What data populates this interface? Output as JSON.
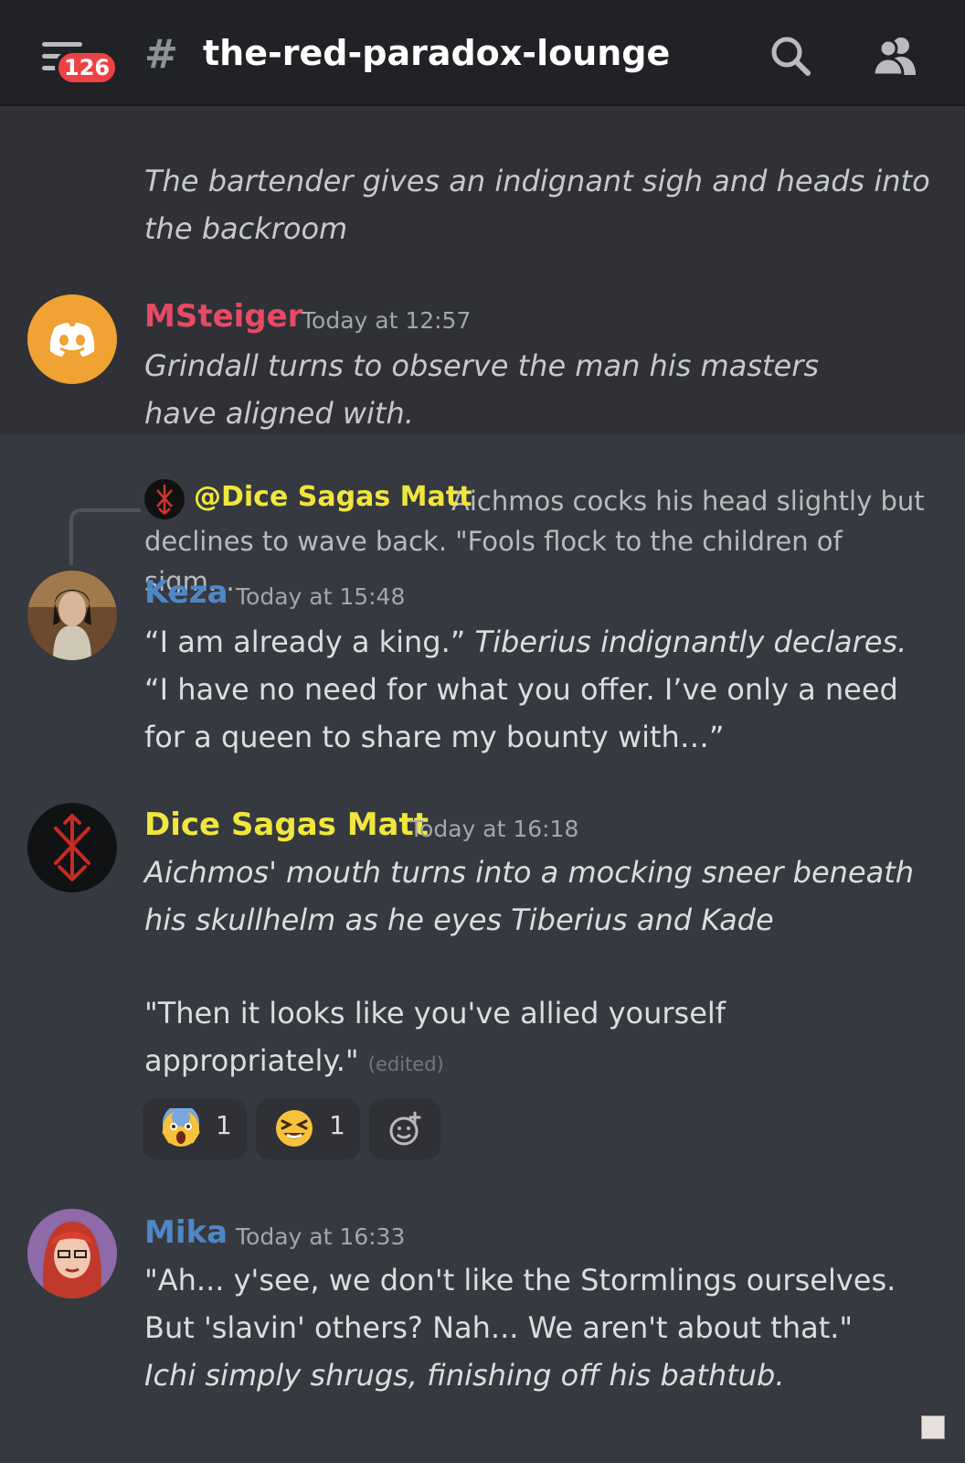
{
  "header": {
    "notification_count": "126",
    "channel_hash": "#",
    "channel_name": "the-red-paradox-lounge"
  },
  "messages": [
    {
      "continuation_text": "The bartender gives an indignant sigh and heads into the backroom"
    },
    {
      "author": "MSteiger",
      "author_color": "#e84a64",
      "timestamp": "Today at 12:57",
      "text": "Grindall turns to observe the man his masters have aligned with."
    },
    {
      "reply": {
        "mention": "@Dice Sagas Matt",
        "preview": "Aichmos cocks his head slightly but declines to wave back.  \"Fools flock to the children of sigm…"
      },
      "author": "Keza",
      "author_color": "#4f86c6",
      "timestamp": "Today at 15:48",
      "text_part1": "“I am already a king.” ",
      "text_part2": "Tiberius indignantly declares.",
      "text_part3": " “I have no need for what you offer. I’ve only a need for a queen to share my bounty with…”"
    },
    {
      "author": "Dice Sagas Matt",
      "author_color": "#f0e63c",
      "timestamp": "Today at 16:18",
      "text_italic": "Aichmos' mouth turns into a mocking sneer beneath his skullhelm as he eyes Tiberius and Kade",
      "text_quote": "\"Then it looks like you've allied yourself appropriately.\"",
      "edited": "(edited)",
      "reactions": [
        {
          "emoji": "screaming-face",
          "count": "1"
        },
        {
          "emoji": "laughing-squint-face",
          "count": "1"
        }
      ]
    },
    {
      "author": "Mika",
      "author_color": "#4f86c6",
      "timestamp": "Today at 16:33",
      "text_line1": "\"Ah... y'see, we don't like the Stormlings ourselves.",
      "text_line2": "But 'slavin' others? Nah... We aren't about that.\"",
      "text_line3": "Ichi simply shrugs, finishing off his bathtub."
    }
  ],
  "colors": {
    "background": "#36393f",
    "top_bar": "#202225",
    "badge": "#ed4245",
    "discord_avatar": "#f0a232"
  }
}
